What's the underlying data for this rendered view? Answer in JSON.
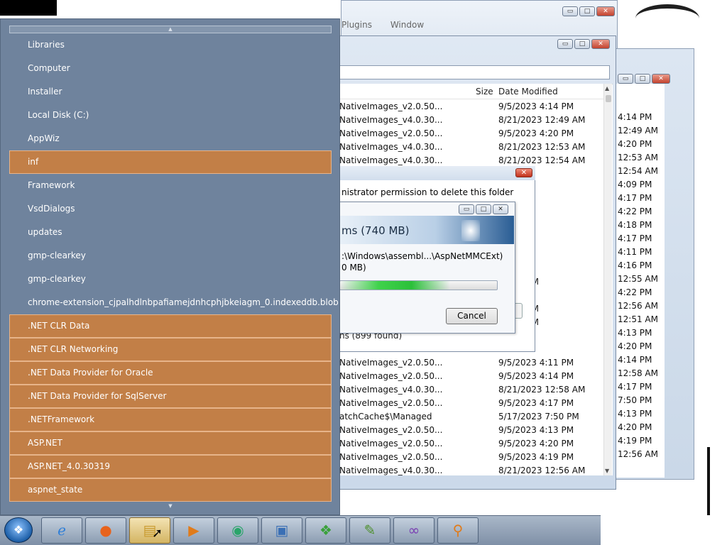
{
  "menu_fragment": [
    "Plugins",
    "Window"
  ],
  "nav_panel": {
    "items": [
      {
        "label": "Libraries",
        "selected": false
      },
      {
        "label": "Computer",
        "selected": false
      },
      {
        "label": "Installer",
        "selected": false
      },
      {
        "label": "Local Disk (C:)",
        "selected": false
      },
      {
        "label": "AppWiz",
        "selected": false
      },
      {
        "label": "inf",
        "selected": true
      },
      {
        "label": "Framework",
        "selected": false
      },
      {
        "label": "VsdDialogs",
        "selected": false
      },
      {
        "label": "updates",
        "selected": false
      },
      {
        "label": "gmp-clearkey",
        "selected": false
      },
      {
        "label": "gmp-clearkey",
        "selected": false
      },
      {
        "label": "chrome-extension_cjpalhdlnbpafiamejdnhcphjbkeiagm_0.indexeddb.blob",
        "selected": false
      },
      {
        "label": ".NET CLR Data",
        "selected": true
      },
      {
        "label": ".NET CLR Networking",
        "selected": true
      },
      {
        "label": ".NET Data Provider for Oracle",
        "selected": true
      },
      {
        "label": ".NET Data Provider for SqlServer",
        "selected": true
      },
      {
        "label": ".NETFramework",
        "selected": true
      },
      {
        "label": "ASP.NET",
        "selected": true
      },
      {
        "label": "ASP.NET_4.0.30319",
        "selected": true
      },
      {
        "label": "aspnet_state",
        "selected": true
      }
    ],
    "scroll_up_glyph": "▲",
    "scroll_down_glyph": "▼"
  },
  "explorer": {
    "columns": {
      "size": "Size",
      "date_modified": "Date Modified"
    },
    "rows": [
      {
        "name": "NativeImages_v2.0.50...",
        "date": "9/5/2023 4:14 PM"
      },
      {
        "name": "NativeImages_v4.0.30...",
        "date": "8/21/2023 12:49 AM"
      },
      {
        "name": "NativeImages_v2.0.50...",
        "date": "9/5/2023 4:20 PM"
      },
      {
        "name": "NativeImages_v4.0.30...",
        "date": "8/21/2023 12:53 AM"
      },
      {
        "name": "NativeImages_v4.0.30...",
        "date": "8/21/2023 12:54 AM"
      },
      {
        "name": "",
        "date": "4:09 PM"
      },
      {
        "name": "",
        "date": "4:17 PM"
      },
      {
        "name": "",
        "date": "4:22 PM"
      },
      {
        "name": "",
        "date": "4:18 PM"
      },
      {
        "name": "",
        "date": "4:17 PM"
      },
      {
        "name": "",
        "date": "4:11 PM"
      },
      {
        "name": "",
        "date": "4:16 PM"
      },
      {
        "name": "",
        "date": "4:20 PM"
      },
      {
        "name": "",
        "date": "12:55 AM"
      },
      {
        "name": "",
        "date": "4:22 PM"
      },
      {
        "name": "",
        "date": "12:56 AM"
      },
      {
        "name": "",
        "date": "12:51 AM"
      },
      {
        "name": "",
        "date": "4:13 PM"
      },
      {
        "name": "",
        "date": "4:20 PM"
      },
      {
        "name": "NativeImages_v2.0.50...",
        "date": "9/5/2023 4:11 PM"
      },
      {
        "name": "NativeImages_v2.0.50...",
        "date": "9/5/2023 4:14 PM"
      },
      {
        "name": "NativeImages_v4.0.30...",
        "date": "8/21/2023 12:58 AM"
      },
      {
        "name": "NativeImages_v2.0.50...",
        "date": "9/5/2023 4:17 PM"
      },
      {
        "name": "atchCache$\\Managed",
        "date": "5/17/2023 7:50 PM"
      },
      {
        "name": "NativeImages_v2.0.50...",
        "date": "9/5/2023 4:13 PM"
      },
      {
        "name": "NativeImages_v2.0.50...",
        "date": "9/5/2023 4:20 PM"
      },
      {
        "name": "NativeImages_v2.0.50...",
        "date": "9/5/2023 4:19 PM"
      },
      {
        "name": "NativeImages_v4.0.30...",
        "date": "8/21/2023 12:56 AM"
      }
    ],
    "side_dates": [
      "4:14 PM",
      "12:49 AM",
      "4:20 PM",
      "12:53 AM",
      "12:54 AM",
      "4:09 PM",
      "4:17 PM",
      "4:22 PM",
      "4:18 PM",
      "4:17 PM",
      "4:11 PM",
      "4:16 PM",
      "12:55 AM",
      "4:22 PM",
      "12:56 AM",
      "12:51 AM",
      "4:13 PM",
      "4:20 PM",
      "4:14 PM",
      "12:58 AM",
      "4:17 PM",
      "7:50 PM",
      "4:13 PM",
      "4:20 PM",
      "4:19 PM",
      "12:56 AM"
    ]
  },
  "confirm_dialog": {
    "message": "nistrator permission to delete this folder",
    "items_found": "ns (899 found)"
  },
  "progress_dialog": {
    "banner": "ms (740 MB)",
    "path": ":\\Windows\\assembl...\\AspNetMMCExt)",
    "size": "0 MB)",
    "progress": 0.7,
    "cancel_label": "Cancel"
  },
  "caption": {
    "minimize": "▭",
    "maximize": "□",
    "close": "✕"
  },
  "taskbar": {
    "start_glyph": "❖",
    "buttons": [
      {
        "name": "internet-explorer-icon",
        "glyph": "ℯ",
        "color": "#2f7fd8",
        "active": false
      },
      {
        "name": "firefox-icon",
        "glyph": "●",
        "color": "#e8631c",
        "active": false
      },
      {
        "name": "file-explorer-icon",
        "glyph": "▤",
        "color": "#c99a2e",
        "active": true
      },
      {
        "name": "media-player-icon",
        "glyph": "▶",
        "color": "#e07b1a",
        "active": false
      },
      {
        "name": "media-center-icon",
        "glyph": "◉",
        "color": "#2aa56a",
        "active": false
      },
      {
        "name": "remote-desktop-icon",
        "glyph": "▣",
        "color": "#3a6fb5",
        "active": false
      },
      {
        "name": "windows-logo-icon",
        "glyph": "❖",
        "color": "#3aa13a",
        "active": false
      },
      {
        "name": "notepad-plus-plus-icon",
        "glyph": "✎",
        "color": "#4c8f2a",
        "active": false
      },
      {
        "name": "visual-studio-icon",
        "glyph": "∞",
        "color": "#7a3fb3",
        "active": false
      },
      {
        "name": "search-magnifier-icon",
        "glyph": "⚲",
        "color": "#e07b1a",
        "active": false
      }
    ]
  }
}
